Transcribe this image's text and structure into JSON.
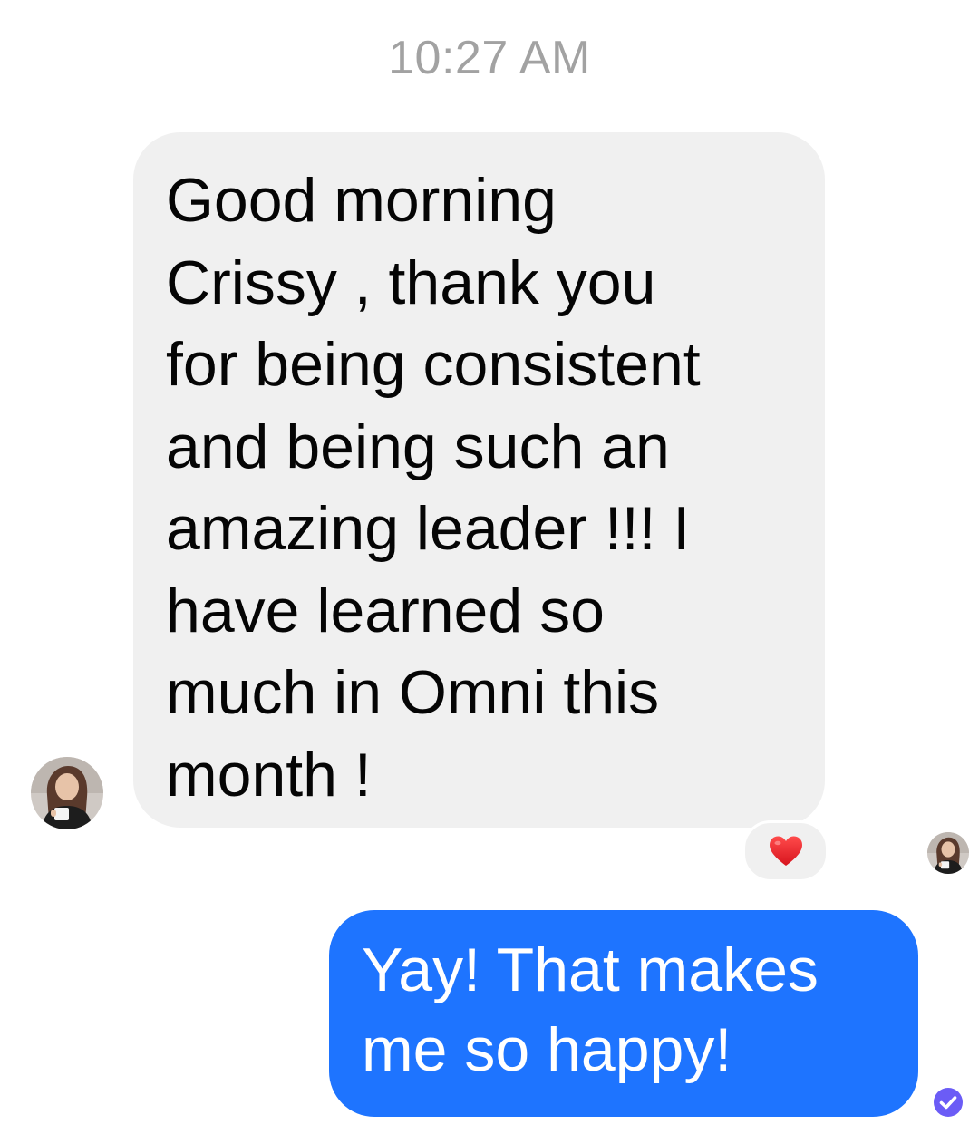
{
  "thread": {
    "timestamp": "10:27 AM"
  },
  "messages": [
    {
      "direction": "incoming",
      "text": "Good morning\nCrissy , thank you\nfor being consistent\nand being such an\namazing leader !!! I\nhave learned so\nmuch in Omni this\nmonth !",
      "reaction": "heart",
      "sender_avatar": "avatar"
    },
    {
      "direction": "outgoing",
      "text": "Yay!  That makes\nme so happy!",
      "seen_by_avatar": "avatar",
      "status": "delivered"
    }
  ],
  "colors": {
    "incoming_bubble": "#f0f0f0",
    "outgoing_bubble": "#1e74ff",
    "timestamp": "#a2a2a2",
    "heart": "#e8202a",
    "status_check": "#6b5cf6"
  },
  "icons": {
    "reaction": "heart-icon",
    "status": "check-circle-icon"
  }
}
